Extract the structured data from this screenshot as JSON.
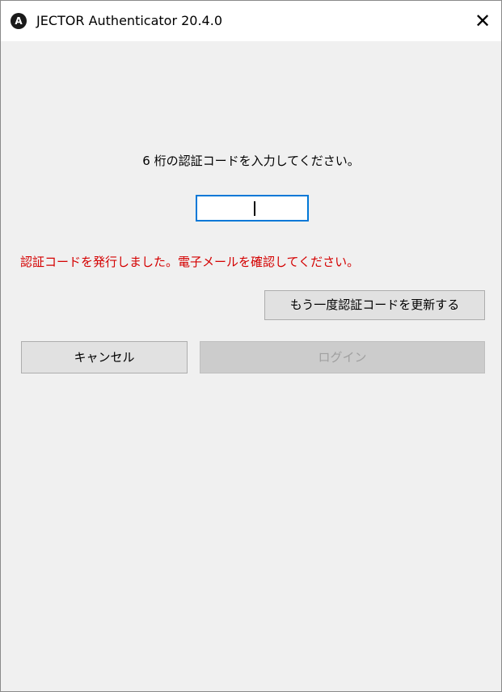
{
  "window": {
    "app_icon_letter": "A",
    "title": "JECTOR Authenticator 20.4.0",
    "close_glyph": "✕"
  },
  "auth": {
    "prompt": "6 桁の認証コードを入力してください。",
    "code_value": "",
    "error_message": "認証コードを発行しました。電子メールを確認してください。",
    "error_color": "#d40000",
    "accent_color": "#0078d7"
  },
  "buttons": {
    "resend_label": "もう一度認証コードを更新する",
    "cancel_label": "キャンセル",
    "login_label": "ログイン",
    "login_enabled": false
  },
  "icons": {
    "app": "app-logo-icon",
    "close": "close-icon"
  }
}
